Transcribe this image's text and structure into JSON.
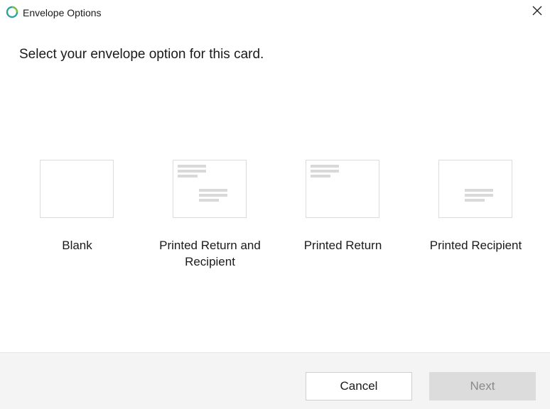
{
  "window": {
    "title": "Envelope Options",
    "app_icon": "circle-logo-icon",
    "close_icon": "close-icon"
  },
  "prompt": "Select your envelope option for this card.",
  "options": [
    {
      "label": "Blank"
    },
    {
      "label": "Printed Return and Recipient"
    },
    {
      "label": "Printed Return"
    },
    {
      "label": "Printed Recipient"
    }
  ],
  "footer": {
    "cancel_label": "Cancel",
    "next_label": "Next",
    "next_enabled": false
  },
  "colors": {
    "accent_teal": "#2fa39a",
    "accent_green": "#7ac143",
    "thumb_line": "#d9d9d9",
    "disabled_bg": "#dcdcdc"
  }
}
